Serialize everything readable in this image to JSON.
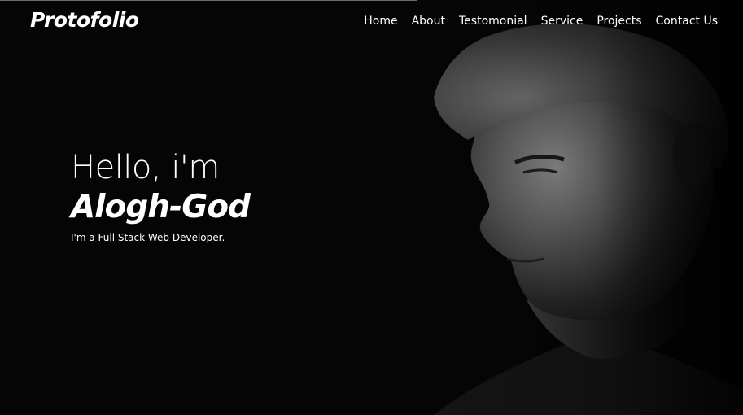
{
  "brand": {
    "logo_text": "Protofolio"
  },
  "nav": {
    "items": [
      {
        "label": "Home"
      },
      {
        "label": "About"
      },
      {
        "label": "Testomonial"
      },
      {
        "label": "Service"
      },
      {
        "label": "Projects"
      },
      {
        "label": "Contact Us"
      }
    ]
  },
  "hero": {
    "greeting": "Hello, i'm",
    "name": "Alogh-God",
    "subtitle": "I'm a Full Stack Web Developer."
  },
  "colors": {
    "background": "#050505",
    "text": "#ffffff"
  }
}
